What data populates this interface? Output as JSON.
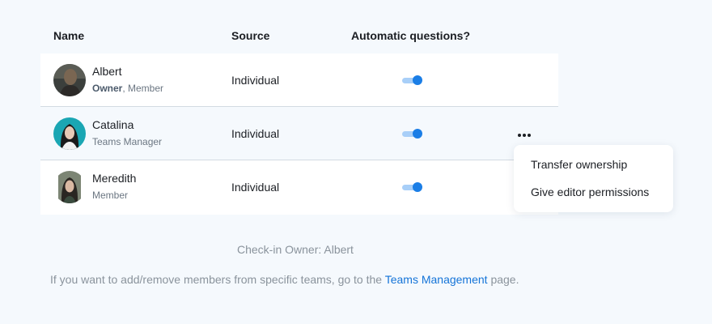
{
  "table": {
    "headers": {
      "name": "Name",
      "source": "Source",
      "automatic": "Automatic questions?"
    },
    "rows": [
      {
        "name": "Albert",
        "role_bold": "Owner",
        "role_rest": ", Member",
        "source": "Individual",
        "automatic_questions": true
      },
      {
        "name": "Catalina",
        "role": "Teams Manager",
        "source": "Individual",
        "automatic_questions": true
      },
      {
        "name": "Meredith",
        "role": "Member",
        "source": "Individual",
        "automatic_questions": true
      }
    ]
  },
  "context_menu": {
    "items": [
      "Transfer ownership",
      "Give editor permissions"
    ]
  },
  "footer": {
    "checkin_owner": "Check-in Owner: Albert",
    "info_prefix": "If you want to add/remove members from specific teams, go to the",
    "info_link": "Teams Management",
    "info_suffix": "page."
  },
  "colors": {
    "accent": "#1b7ee6",
    "toggle_track": "#a8cff8",
    "background": "#f5f9fd",
    "link": "#1474d8"
  },
  "icons": {
    "row_actions": "more-horizontal-icon"
  }
}
